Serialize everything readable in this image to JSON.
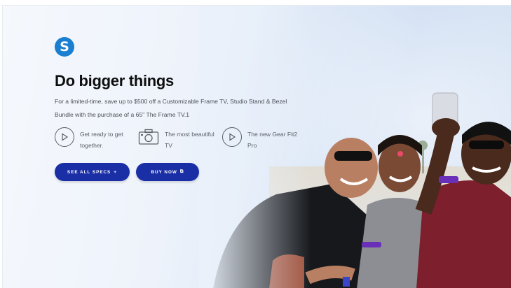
{
  "brand": {
    "logo_letter": "S",
    "logo_color": "#1a7fd1"
  },
  "hero": {
    "headline": "Do bigger things",
    "promo_text": "For a limited-time, save up to $500 off a Customizable Frame TV, Studio Stand & Bezel Bundle with the purchase of a 65\" The Frame TV.1"
  },
  "features": [
    {
      "icon": "play-circle-icon",
      "label": "Get ready to get together."
    },
    {
      "icon": "camera-icon",
      "label": "The most beautiful TV"
    },
    {
      "icon": "play-circle-icon",
      "label": "The new Gear Fit2 Pro"
    }
  ],
  "buttons": {
    "specs_label": "SEE ALL SPECS",
    "specs_glyph": "+",
    "buy_label": "BUY NOW",
    "buy_glyph": "⧉",
    "color": "#1a2fa6"
  },
  "photo": {
    "subject": "friends-selfie-image"
  }
}
